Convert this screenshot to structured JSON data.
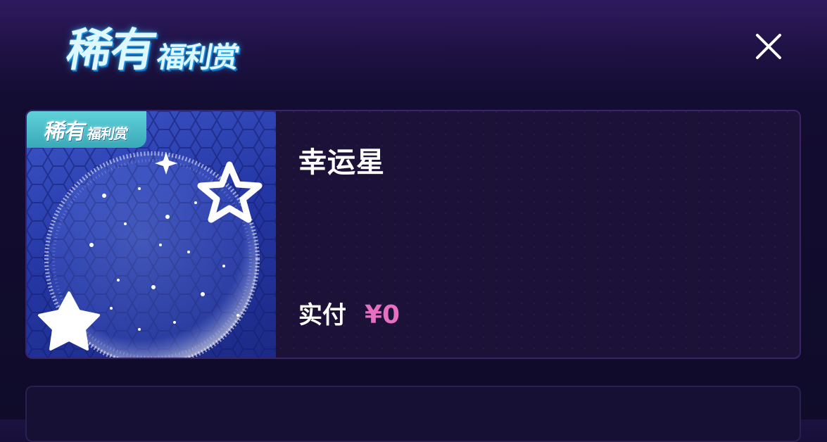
{
  "header": {
    "title_main": "稀有",
    "title_sub": "福利赏",
    "close_icon": "close-icon"
  },
  "product": {
    "badge_main": "稀有",
    "badge_sub": "福利赏",
    "name": "幸运星",
    "price_label": "实付",
    "price_value": "¥0",
    "price_color": "#e66fc2",
    "image_icon": "star-sphere-icon"
  },
  "colors": {
    "background": "#0f0b29",
    "card_border": "#3a2468",
    "badge": "#4fc1cc",
    "thumb": "#2a3ab0"
  }
}
